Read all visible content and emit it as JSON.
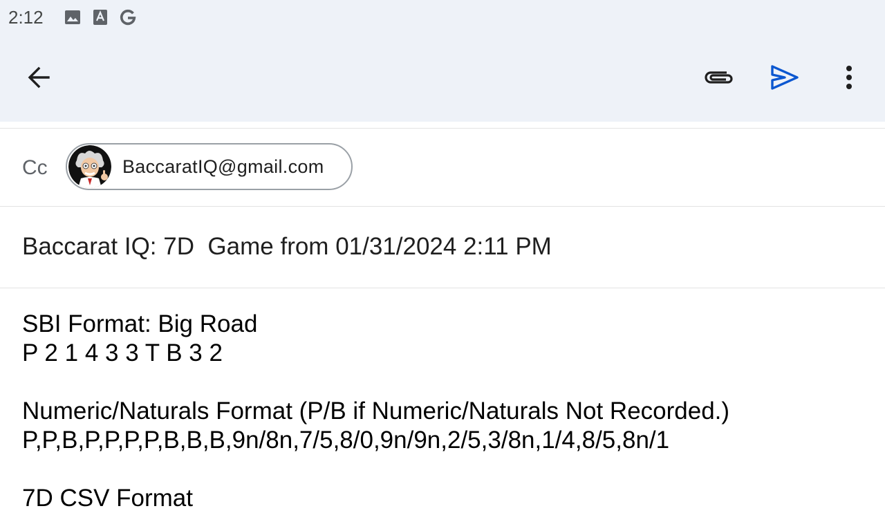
{
  "status_bar": {
    "time": "2:12",
    "icons": [
      "image-icon",
      "font-a-icon",
      "google-g-icon"
    ]
  },
  "toolbar": {
    "back_icon": "arrow-back-icon",
    "attach_icon": "paperclip-icon",
    "send_icon": "send-icon",
    "more_icon": "more-vert-icon",
    "accent_color": "#0b57d0"
  },
  "cc": {
    "label": "Cc",
    "recipient": "BaccaratIQ@gmail.com"
  },
  "subject": "Baccarat IQ: 7D  Game from 01/31/2024 2:11 PM",
  "body": {
    "sbi_title": "SBI Format: Big Road",
    "sbi_value": "P 2 1 4 3 3 T B 3 2",
    "numeric_title": "Numeric/Naturals Format (P/B if Numeric/Naturals Not Recorded.)",
    "numeric_value": "P,P,B,P,P,P,P,B,B,B,9n/8n,7/5,8/0,9n/9n,2/5,3/8n,1/4,8/5,8n/1",
    "csv_title": "7D CSV Format"
  }
}
